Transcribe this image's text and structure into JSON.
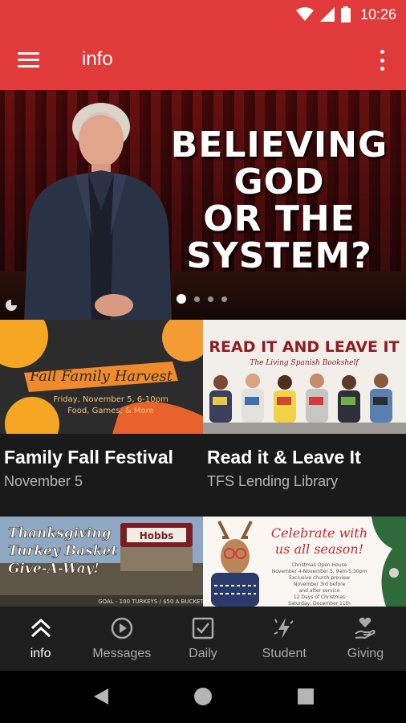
{
  "status_bar": {
    "time": "10:26"
  },
  "app_bar": {
    "title": "info"
  },
  "hero": {
    "headline_lines": [
      "BELIEVING",
      "GOD",
      "OR THE",
      "SYSTEM?"
    ],
    "slide_count": 4,
    "active_slide": 1
  },
  "cards": [
    {
      "title": "Family Fall Festival",
      "subtitle": "November 5",
      "image_text": {
        "title": "Fall Family Harvest",
        "line1": "Friday, November 5, 6-10pm",
        "line2": "Food, Games, & More"
      }
    },
    {
      "title": "Read it & Leave It",
      "subtitle": "TFS Lending Library",
      "image_text": {
        "title": "READ IT AND LEAVE IT",
        "line1": "The Living Spanish Bookshelf"
      }
    },
    {
      "title": "",
      "subtitle": "",
      "image_text": {
        "title_line1": "Thanksgiving",
        "title_line2": "Turkey Basket",
        "title_line3": "Give-A-Way!",
        "sign": "Hobbs",
        "footer": "GOAL - 100 TURKEYS / $50 A BUCKET"
      }
    },
    {
      "title": "",
      "subtitle": "",
      "image_text": {
        "title_line1": "Celebrate with",
        "title_line2": "us all season!",
        "line1": "Christmas Open House",
        "line2": "November 4-November 5, 9am-5:30pm",
        "line3": "Exclusive church preview",
        "line4": "November 3rd before",
        "line5": "and after service",
        "line6": "12 Days of Christmas",
        "line7": "Saturday, December 11th"
      }
    }
  ],
  "bottom_nav": [
    {
      "label": "info",
      "icon": "double-chevron-up-icon",
      "active": true
    },
    {
      "label": "Messages",
      "icon": "play-circle-icon",
      "active": false
    },
    {
      "label": "Daily",
      "icon": "checkbox-icon",
      "active": false
    },
    {
      "label": "Student",
      "icon": "lightning-star-icon",
      "active": false
    },
    {
      "label": "Giving",
      "icon": "hand-heart-icon",
      "active": false
    }
  ],
  "colors": {
    "primary": "#e03a3a",
    "nav_background": "#1e1e1e",
    "content_background": "#1a1a1a"
  }
}
